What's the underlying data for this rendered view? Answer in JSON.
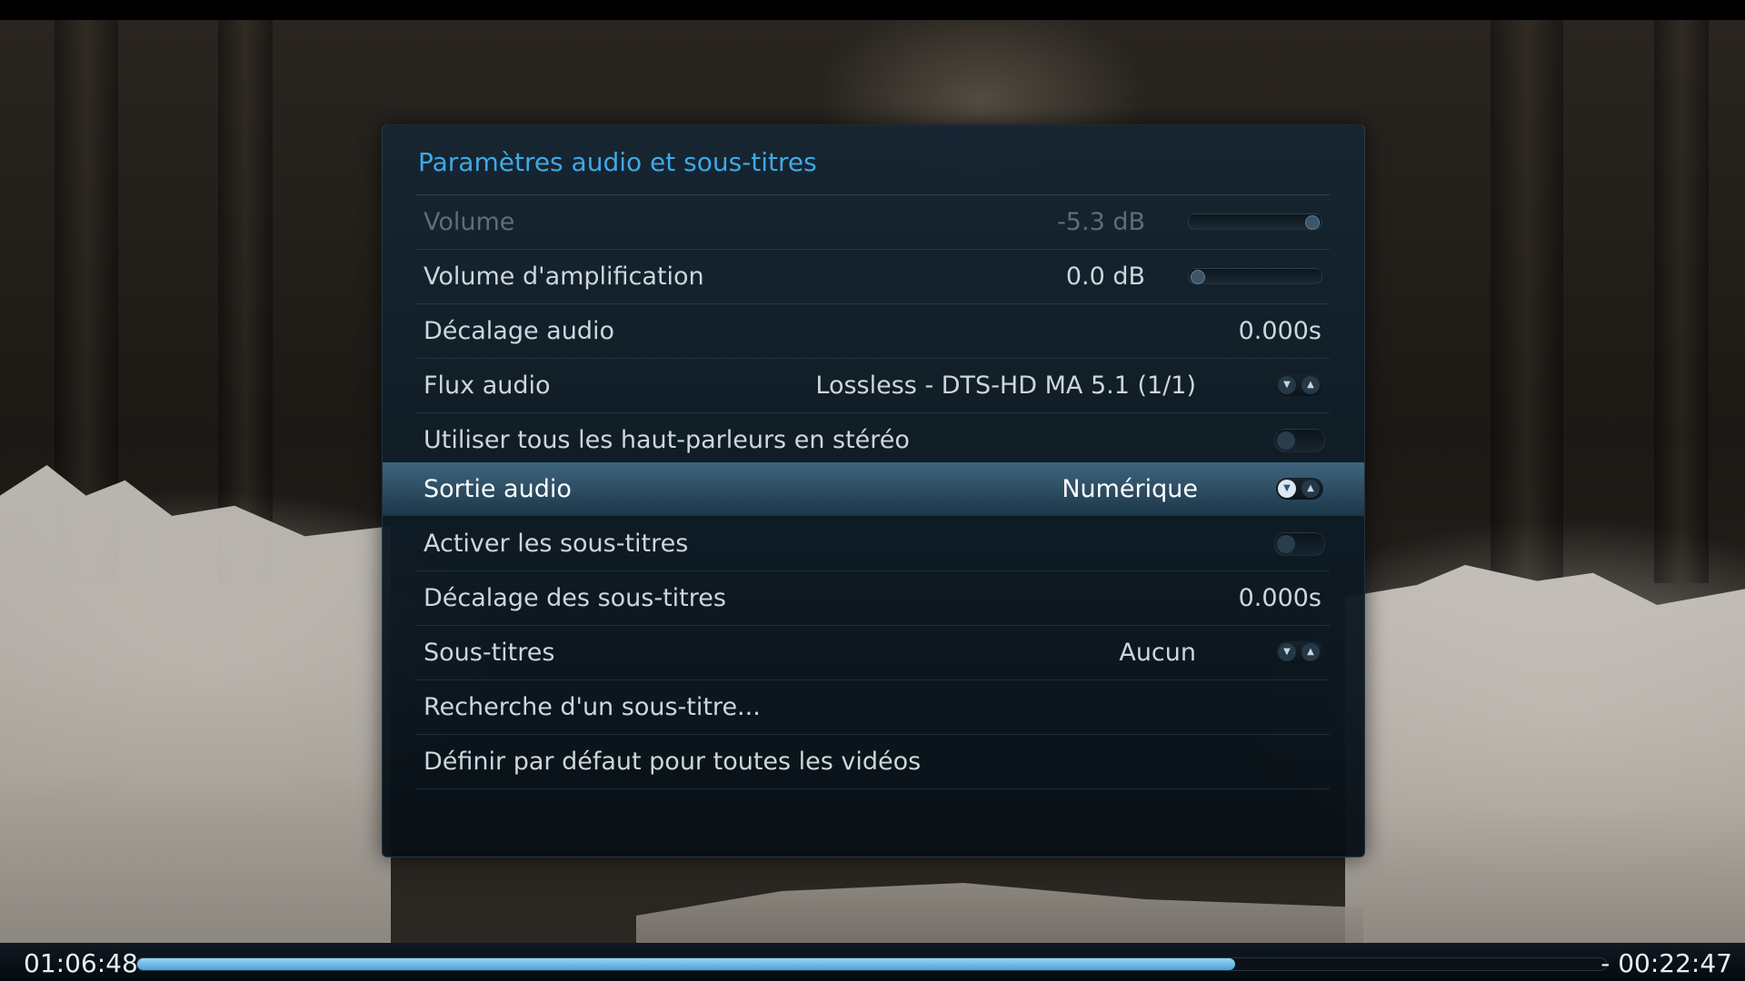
{
  "dialog": {
    "title": "Paramètres audio et sous-titres",
    "rows": [
      {
        "label": "Volume",
        "value": "-5.3 dB",
        "control": "slider",
        "level": 1.0,
        "disabled": true
      },
      {
        "label": "Volume d'amplification",
        "value": "0.0 dB",
        "control": "slider",
        "level": 0.0
      },
      {
        "label": "Décalage audio",
        "value": "0.000s"
      },
      {
        "label": "Flux audio",
        "value": "Lossless - DTS-HD MA 5.1 (1/1)",
        "control": "spinner"
      },
      {
        "label": "Utiliser tous les haut-parleurs en stéréo",
        "control": "toggle",
        "checked": false
      },
      {
        "label": "Sortie audio",
        "value": "Numérique",
        "control": "spinner",
        "focused": true
      },
      {
        "label": "Activer les sous-titres",
        "control": "toggle",
        "checked": false
      },
      {
        "label": "Décalage des sous-titres",
        "value": "0.000s"
      },
      {
        "label": "Sous-titres",
        "value": "Aucun",
        "control": "spinner"
      },
      {
        "label": "Recherche d'un sous-titre..."
      },
      {
        "label": "Définir par défaut pour toutes les vidéos"
      }
    ]
  },
  "osd": {
    "elapsed": "01:06:48",
    "remaining": "- 00:22:47",
    "progress": 0.7475
  },
  "icons": {
    "spin_down": "chevron-down-icon",
    "spin_up": "chevron-up-icon"
  },
  "colors": {
    "accent": "#3ea9e6",
    "progress": "#6cbbe8"
  }
}
